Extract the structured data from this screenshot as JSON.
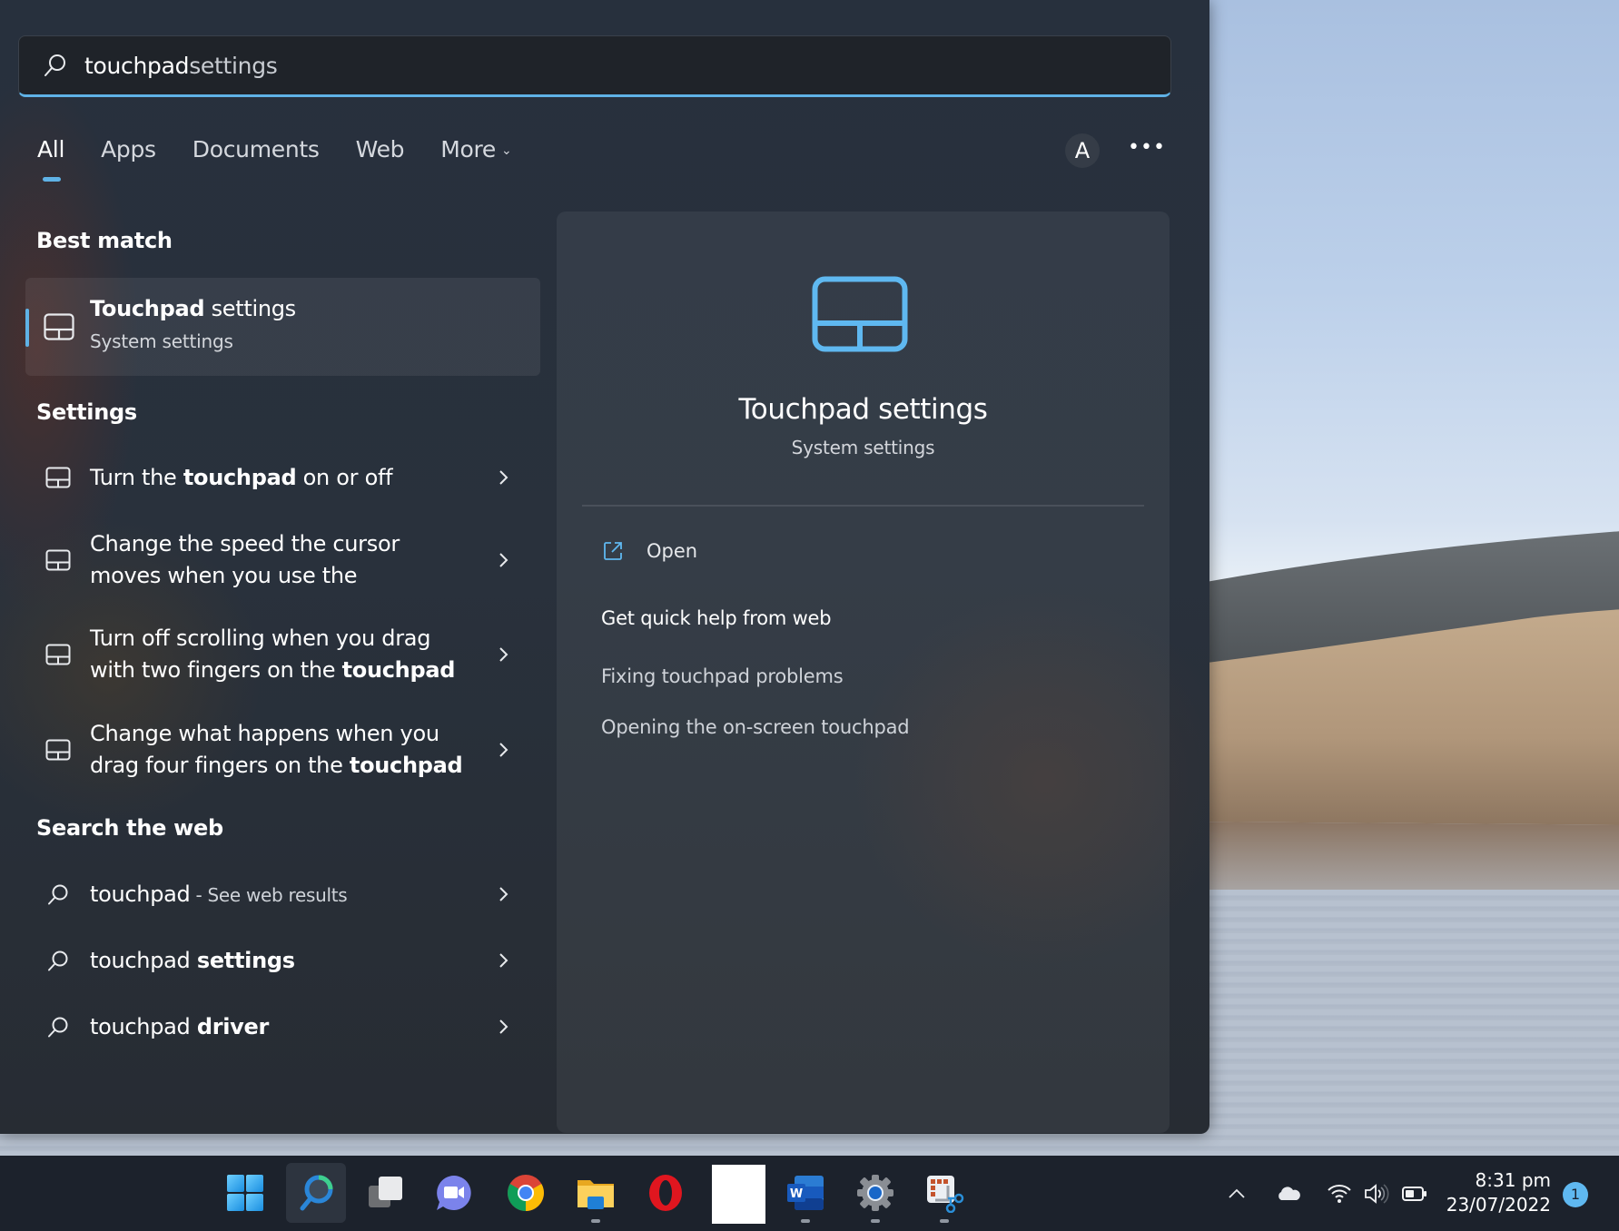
{
  "search": {
    "query_typed": "touchpad",
    "query_suggestion": " settings",
    "icon": "search-icon"
  },
  "tabs": [
    {
      "label": "All",
      "active": true
    },
    {
      "label": "Apps",
      "active": false
    },
    {
      "label": "Documents",
      "active": false
    },
    {
      "label": "Web",
      "active": false
    },
    {
      "label": "More",
      "active": false,
      "icon": "chevron-down-icon"
    }
  ],
  "account": {
    "avatar_letter": "A",
    "more_icon": "ellipsis-icon",
    "more_label": "•••"
  },
  "best_match": {
    "heading": "Best match",
    "title_bold": "Touchpad",
    "title_rest": " settings",
    "subtitle": "System settings",
    "icon": "touchpad-icon"
  },
  "settings": {
    "heading": "Settings",
    "items": [
      {
        "parts": [
          [
            "Turn the ",
            false
          ],
          [
            "touchpad",
            true
          ],
          [
            " on or off",
            false
          ]
        ]
      },
      {
        "parts": [
          [
            "Change the speed the cursor",
            false
          ],
          [
            "\n",
            false
          ],
          [
            "moves when you use the",
            false
          ]
        ]
      },
      {
        "parts": [
          [
            "Turn off scrolling when you drag",
            false
          ],
          [
            "\n",
            false
          ],
          [
            "with two fingers on the ",
            false
          ],
          [
            "touchpad",
            true
          ]
        ]
      },
      {
        "parts": [
          [
            "Change what happens when you",
            false
          ],
          [
            "\n",
            false
          ],
          [
            "drag four fingers on the ",
            false
          ],
          [
            "touchpad",
            true
          ]
        ]
      }
    ]
  },
  "web": {
    "heading": "Search the web",
    "items": [
      {
        "plain": "touchpad",
        "bold": "",
        "suffix": " - See web results"
      },
      {
        "plain": "touchpad ",
        "bold": "settings",
        "suffix": ""
      },
      {
        "plain": "touchpad ",
        "bold": "driver",
        "suffix": ""
      }
    ]
  },
  "preview": {
    "title": "Touchpad settings",
    "subtitle": "System settings",
    "open_label": "Open",
    "quick_help_heading": "Get quick help from web",
    "links": [
      "Fixing touchpad problems",
      "Opening the on-screen touchpad"
    ]
  },
  "taskbar": {
    "apps": [
      {
        "name": "start",
        "icon": "windows-start-icon",
        "active": false,
        "running": false
      },
      {
        "name": "search",
        "icon": "search-app-icon",
        "active": true,
        "running": false
      },
      {
        "name": "task-view",
        "icon": "task-view-icon",
        "active": false,
        "running": false
      },
      {
        "name": "teams-chat",
        "icon": "teams-chat-icon",
        "active": false,
        "running": false
      },
      {
        "name": "chrome",
        "icon": "chrome-icon",
        "active": false,
        "running": false
      },
      {
        "name": "file-explorer",
        "icon": "folder-icon",
        "active": false,
        "running": true
      },
      {
        "name": "opera",
        "icon": "opera-icon",
        "active": false,
        "running": false
      },
      {
        "name": "blank-app",
        "icon": "blank-app-icon",
        "active": false,
        "running": false
      },
      {
        "name": "word",
        "icon": "word-icon",
        "active": false,
        "running": true
      },
      {
        "name": "settings",
        "icon": "settings-gear-icon",
        "active": false,
        "running": true
      },
      {
        "name": "snipping-tool",
        "icon": "snipping-tool-icon",
        "active": false,
        "running": true
      }
    ],
    "tray": {
      "icons": [
        "chevron-up-icon",
        "onedrive-cloud-icon",
        "wifi-icon",
        "volume-icon",
        "battery-icon"
      ],
      "time": "8:31 pm",
      "date": "23/07/2022",
      "notification_count": "1"
    }
  },
  "colors": {
    "accent": "#5fb2e6",
    "flyout_bg": "#29313c",
    "taskbar_bg": "#1c222c"
  }
}
